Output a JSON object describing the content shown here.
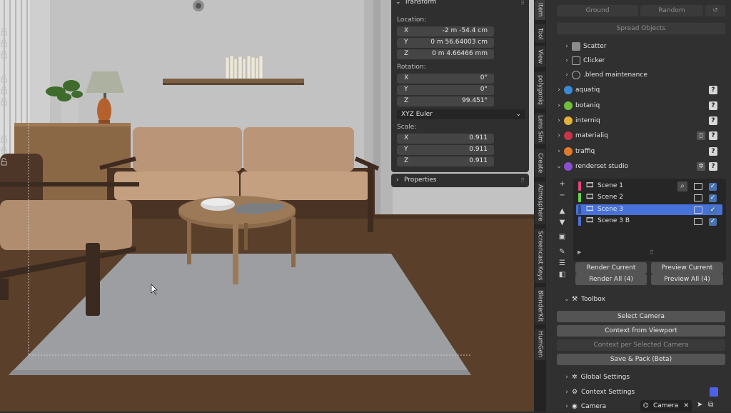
{
  "transform": {
    "title": "Transform",
    "location_label": "Location:",
    "location": [
      {
        "axis": "X",
        "value": "-2 m -54.4 cm"
      },
      {
        "axis": "Y",
        "value": "0 m 56.64003 cm"
      },
      {
        "axis": "Z",
        "value": "0 m 4.66466 mm"
      }
    ],
    "rotation_label": "Rotation:",
    "rotation": [
      {
        "axis": "X",
        "value": "0°"
      },
      {
        "axis": "Y",
        "value": "0°"
      },
      {
        "axis": "Z",
        "value": "99.451°"
      }
    ],
    "euler_mode": "XYZ Euler",
    "scale_label": "Scale:",
    "scale": [
      {
        "axis": "X",
        "value": "0.911"
      },
      {
        "axis": "Y",
        "value": "0.911"
      },
      {
        "axis": "Z",
        "value": "0.911"
      }
    ]
  },
  "properties": {
    "title": "Properties"
  },
  "tabs": [
    "Item",
    "Tool",
    "View",
    "polygoniq",
    "Lens Sim",
    "Create",
    "Atmosphere",
    "Screencast Keys",
    "BlenderKit",
    "HumGen"
  ],
  "top_buttons": {
    "ground": "Ground",
    "random": "Random",
    "spread": "Spread Objects"
  },
  "tree": {
    "scatter": "Scatter",
    "clicker": "Clicker",
    "blend_maintenance": ".blend maintenance",
    "aquatiq": "aquatiq",
    "botaniq": "botaniq",
    "interniq": "interniq",
    "materialiq": "materialiq",
    "traffiq": "traffiq",
    "renderset": "renderset studio"
  },
  "scenes": [
    {
      "name": "Scene 1",
      "color": "#e0457b"
    },
    {
      "name": "Scene 2",
      "color": "#6ad14b"
    },
    {
      "name": "Scene 3",
      "color": "#4772d9"
    },
    {
      "name": "Scene 3 B",
      "color": "#4e6fd6"
    }
  ],
  "render": {
    "render_current": "Render Current",
    "preview_current": "Preview Current",
    "render_all": "Render All (4)",
    "preview_all": "Preview All (4)"
  },
  "toolbox": {
    "title": "Toolbox",
    "select_camera": "Select Camera",
    "context_viewport": "Context from Viewport",
    "context_per_camera": "Context per Selected Camera",
    "save_pack": "Save & Pack (Beta)"
  },
  "settings": {
    "global": "Global Settings",
    "context": "Context Settings",
    "camera": "Camera",
    "camera_field": "Camera"
  },
  "colors": {
    "accent": "#4772b3",
    "selected_row": "#4772d9",
    "panel_bg": "#303030"
  }
}
